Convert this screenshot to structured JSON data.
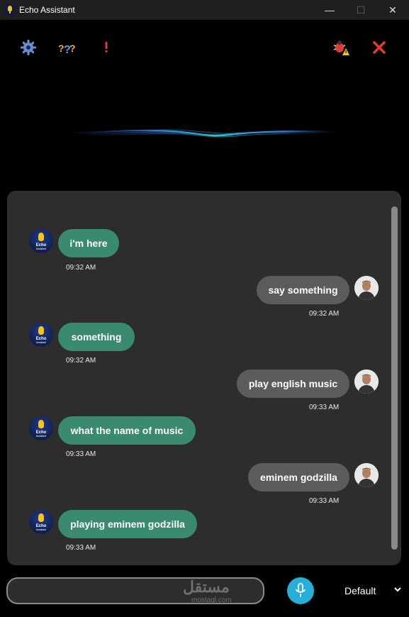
{
  "window": {
    "title": "Echo Assistant",
    "minimize": "—",
    "maximize": "☐",
    "close": "✕"
  },
  "toolbar": {
    "settings_icon": "gear-icon",
    "help_icon": "question-icon",
    "alert_icon": "exclamation-icon",
    "bug_icon": "bug-icon",
    "close_icon": "close-icon"
  },
  "messages": [
    {
      "sender": "bot",
      "text": "i'm here",
      "time": "09:32 AM"
    },
    {
      "sender": "user",
      "text": "say something",
      "time": "09:32 AM"
    },
    {
      "sender": "bot",
      "text": "something",
      "time": "09:32 AM"
    },
    {
      "sender": "user",
      "text": "play english music",
      "time": "09:33 AM"
    },
    {
      "sender": "bot",
      "text": "what the name of music",
      "time": "09:33 AM"
    },
    {
      "sender": "user",
      "text": "eminem godzilla",
      "time": "09:33 AM"
    },
    {
      "sender": "bot",
      "text": "playing eminem godzilla",
      "time": "09:33 AM"
    }
  ],
  "bot_avatar_label": "Echo",
  "bot_avatar_sub": "Assistant",
  "input": {
    "value": "",
    "placeholder": ""
  },
  "voice": {
    "selected": "Default"
  },
  "watermark": {
    "text": "مستقل",
    "sub": "mostaql.com"
  },
  "colors": {
    "bot_bubble": "#3a8a6e",
    "user_bubble": "#5c5c5c",
    "mic": "#26b0d9",
    "close_x": "#e53935"
  }
}
